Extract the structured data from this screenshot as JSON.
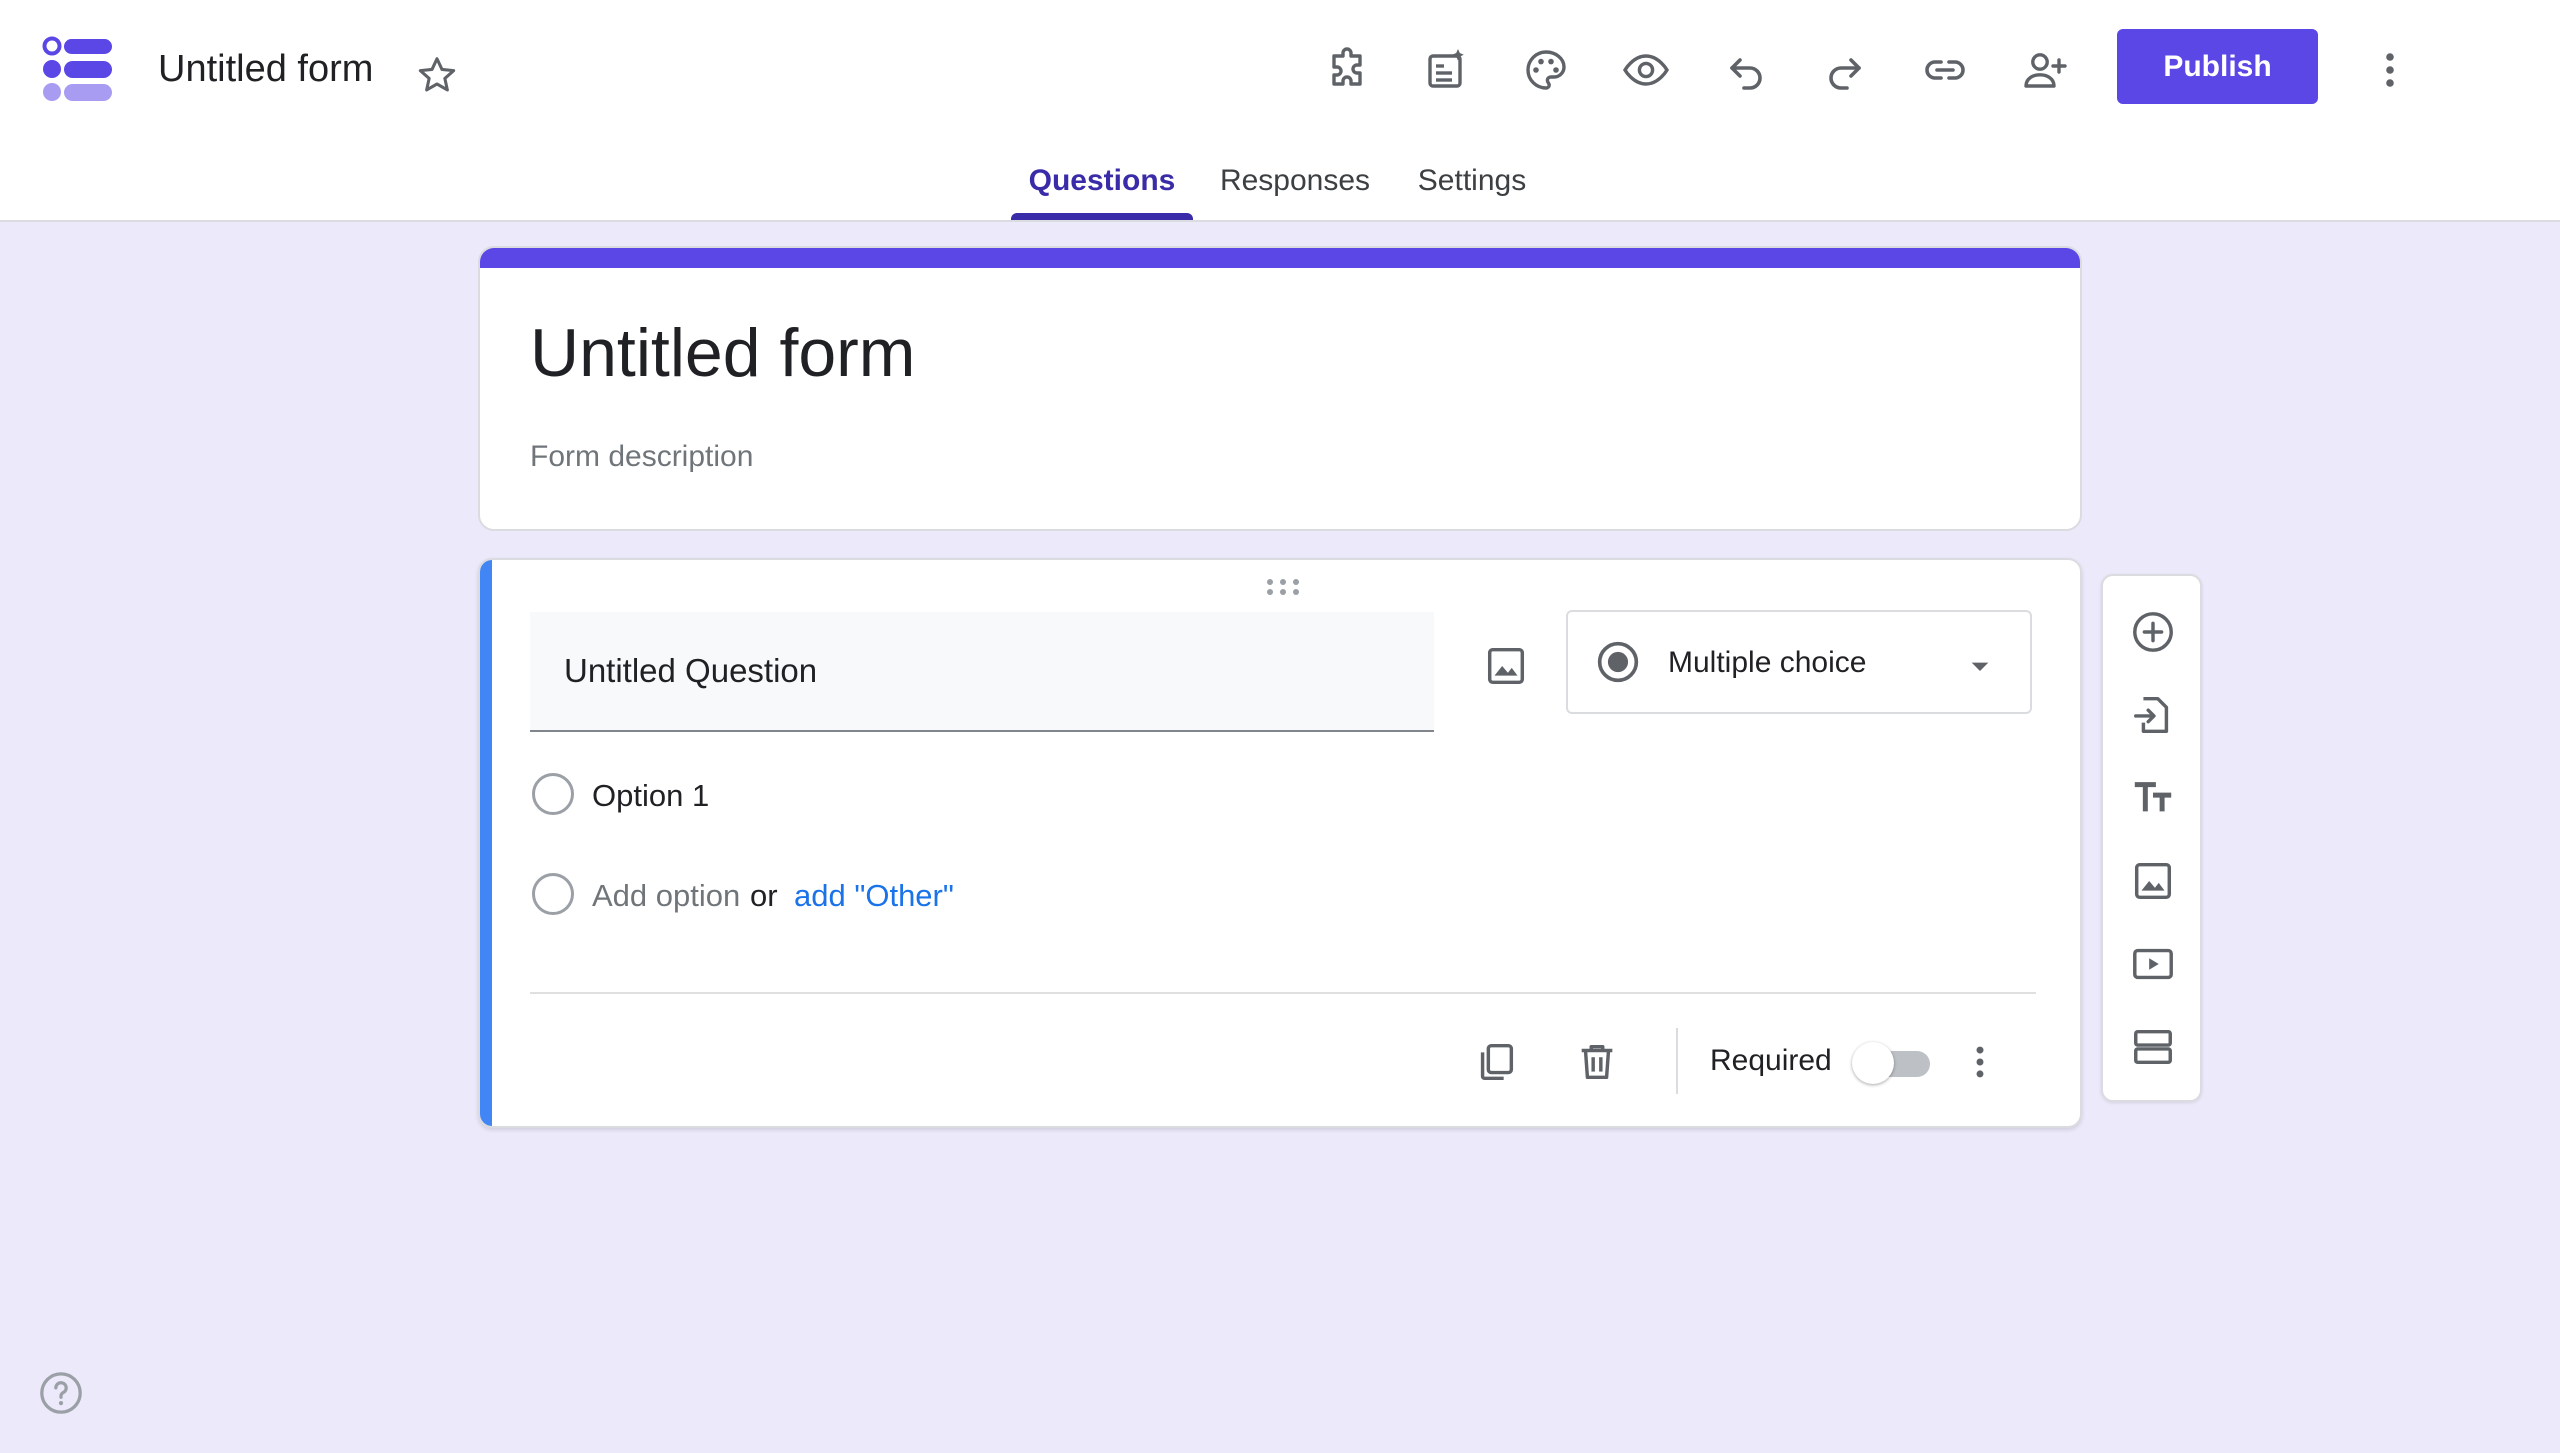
{
  "header": {
    "app_title": "Untitled form",
    "publish_label": "Publish",
    "toolbar_icons": [
      "addons-icon",
      "ai-summary-icon",
      "palette-icon",
      "preview-eye-icon",
      "undo-icon",
      "redo-icon",
      "link-icon",
      "add-collaborator-icon"
    ]
  },
  "tabs": [
    {
      "label": "Questions",
      "active": true
    },
    {
      "label": "Responses",
      "active": false
    },
    {
      "label": "Settings",
      "active": false
    }
  ],
  "form": {
    "title": "Untitled form",
    "description_placeholder": "Form description"
  },
  "question": {
    "title": "Untitled Question",
    "type": "Multiple choice",
    "options": [
      "Option 1"
    ],
    "add_option": "Add option",
    "or": "or",
    "add_other": "add \"Other\"",
    "required_label": "Required",
    "required": false
  },
  "side_toolbar": [
    "add-question-icon",
    "import-questions-icon",
    "add-title-icon",
    "add-image-icon",
    "add-video-icon",
    "add-section-icon"
  ],
  "colors": {
    "accent": "#5b46e6",
    "tab_active": "#3a2ca8",
    "question_bar": "#4285f4",
    "background": "#ece9fb",
    "link": "#1a73e8"
  }
}
